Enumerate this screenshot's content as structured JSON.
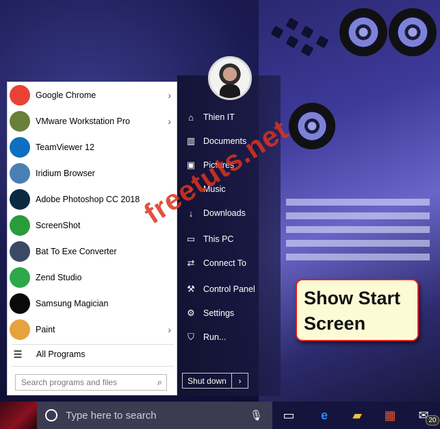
{
  "programs": [
    {
      "label": "Google Chrome",
      "icon": "chrome-icon",
      "color": "#ea4335",
      "has_arrow": true
    },
    {
      "label": "VMware Workstation Pro",
      "icon": "vmware-icon",
      "color": "#6a7f3a",
      "has_arrow": true
    },
    {
      "label": "TeamViewer 12",
      "icon": "teamviewer-icon",
      "color": "#0e6fc1",
      "has_arrow": false
    },
    {
      "label": "Iridium Browser",
      "icon": "iridium-icon",
      "color": "#4a7fb5",
      "has_arrow": false
    },
    {
      "label": "Adobe Photoshop CC 2018",
      "icon": "photoshop-icon",
      "color": "#0a2a44",
      "has_arrow": true
    },
    {
      "label": "ScreenShot",
      "icon": "screenshot-icon",
      "color": "#2a9c3a",
      "has_arrow": false
    },
    {
      "label": "Bat To Exe Converter",
      "icon": "bat-converter-icon",
      "color": "#3a4a66",
      "has_arrow": false
    },
    {
      "label": "Zend Studio",
      "icon": "zend-studio-icon",
      "color": "#2da84a",
      "has_arrow": false
    },
    {
      "label": "Samsung Magician",
      "icon": "samsung-magician-icon",
      "color": "#0a0a0a",
      "has_arrow": false
    },
    {
      "label": "Paint",
      "icon": "paint-icon",
      "color": "#e6a23c",
      "has_arrow": true
    }
  ],
  "all_programs": "All Programs",
  "search": {
    "placeholder": "Search programs and files"
  },
  "user": {
    "name": "Thien IT"
  },
  "nav": [
    {
      "label": "Thien IT",
      "icon": "user-folder-icon"
    },
    {
      "label": "Documents",
      "icon": "documents-icon"
    },
    {
      "label": "Pictures",
      "icon": "pictures-icon"
    },
    {
      "label": "Music",
      "icon": "music-icon"
    },
    {
      "label": "Downloads",
      "icon": "downloads-icon"
    },
    {
      "label": "This PC",
      "icon": "computer-icon"
    },
    {
      "label": "Connect To",
      "icon": "connect-icon"
    },
    {
      "label": "Control Panel",
      "icon": "wrench-icon"
    },
    {
      "label": "Settings",
      "icon": "gear-icon"
    },
    {
      "label": "Run...",
      "icon": "run-icon"
    }
  ],
  "shutdown": {
    "label": "Shut down"
  },
  "callout": {
    "line1": "Show Start",
    "line2": "Screen"
  },
  "watermark": "freetuts.net",
  "taskbar": {
    "search_placeholder": "Type here to search",
    "badge": "20"
  },
  "colors": {
    "callout_border": "#dd2222",
    "callout_bg": "#fdfbd4",
    "taskbar": "#14143c"
  }
}
